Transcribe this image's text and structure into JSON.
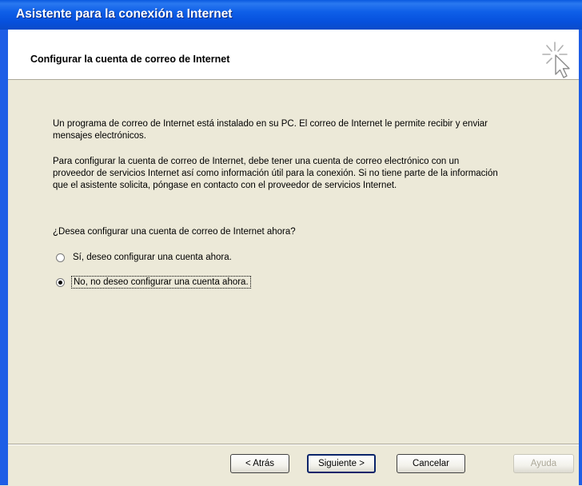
{
  "window": {
    "title": "Asistente para la conexión a Internet"
  },
  "header": {
    "title": "Configurar la cuenta de correo de Internet",
    "icon": "wizard-cursor-icon"
  },
  "body": {
    "paragraph1": "Un programa de correo de Internet está instalado en su PC. El correo de Internet le permite recibir y enviar mensajes electrónicos.",
    "paragraph2": "Para configurar la cuenta de correo de Internet, debe tener una cuenta de correo electrónico con un proveedor de servicios Internet así como información útil para la conexión. Si no tiene parte de la información que el asistente solicita, póngase en contacto con el proveedor de servicios Internet.",
    "question": "¿Desea configurar una cuenta de correo de Internet ahora?",
    "options": [
      {
        "label": "Sí, deseo configurar una cuenta ahora.",
        "checked": false
      },
      {
        "label": "No, no deseo configurar una cuenta ahora.",
        "checked": true
      }
    ]
  },
  "buttons": {
    "back": "< Atrás",
    "next": "Siguiente >",
    "cancel": "Cancelar",
    "help": "Ayuda"
  },
  "colors": {
    "titlebar": "#0a5ae0",
    "dialog_bg": "#ece9d8",
    "header_bg": "#ffffff"
  }
}
